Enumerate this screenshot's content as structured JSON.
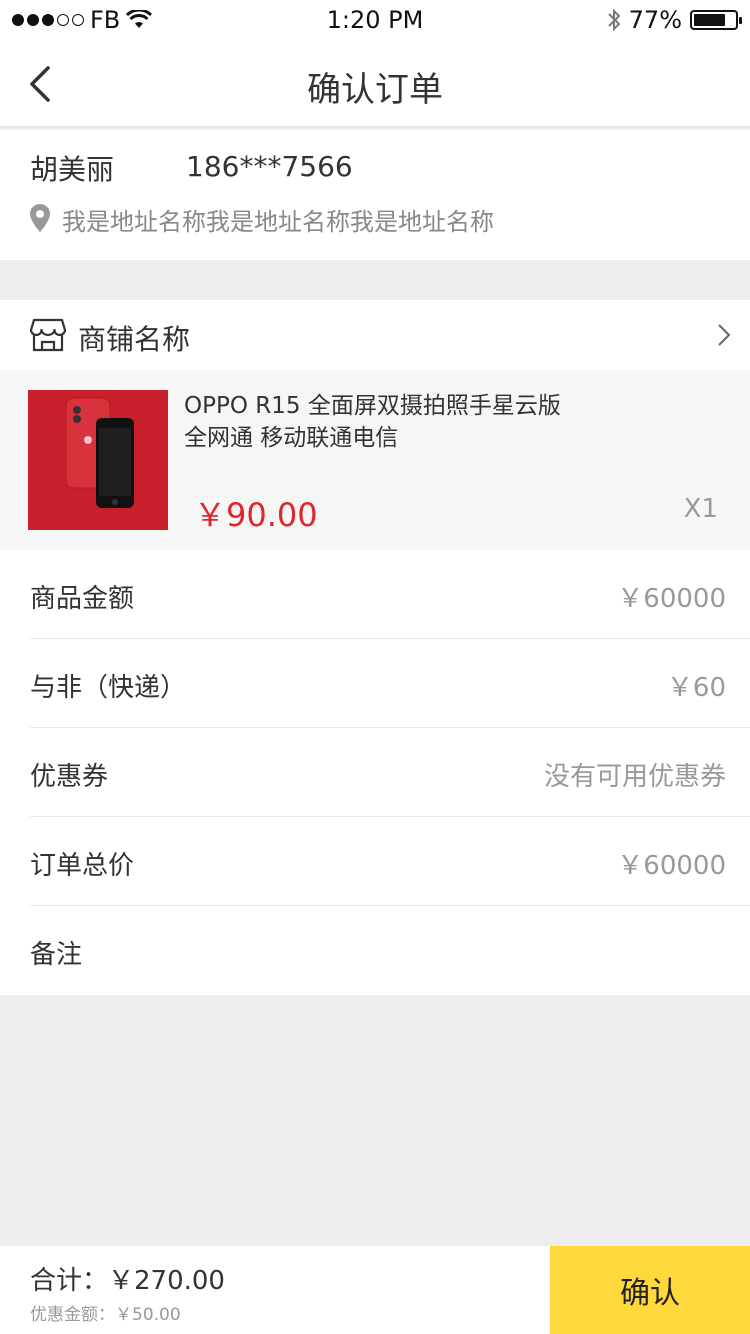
{
  "status": {
    "carrier": "FB",
    "time": "1:20 PM",
    "battery": "77%",
    "battery_level": 0.77
  },
  "nav": {
    "title": "确认订单"
  },
  "address": {
    "name": "胡美丽",
    "phone": "186***7566",
    "text": "我是地址名称我是地址名称我是地址名称"
  },
  "store": {
    "name": "商铺名称"
  },
  "product": {
    "name": "OPPO R15 全面屏双摄拍照手星云版 全网通 移动联通电信",
    "price": "￥90.00",
    "qty": "X1"
  },
  "rows": [
    {
      "label": "商品金额",
      "value": "￥60000"
    },
    {
      "label": "与非（快递）",
      "value": "￥60"
    },
    {
      "label": "优惠券",
      "value": "没有可用优惠券"
    },
    {
      "label": "订单总价",
      "value": "￥60000"
    },
    {
      "label": "备注",
      "value": ""
    }
  ],
  "footer": {
    "total": "合计：￥270.00",
    "discount": "优惠金额：￥50.00",
    "confirm": "确认"
  },
  "colors": {
    "accent": "#ffd93b",
    "price": "#e0262c"
  }
}
